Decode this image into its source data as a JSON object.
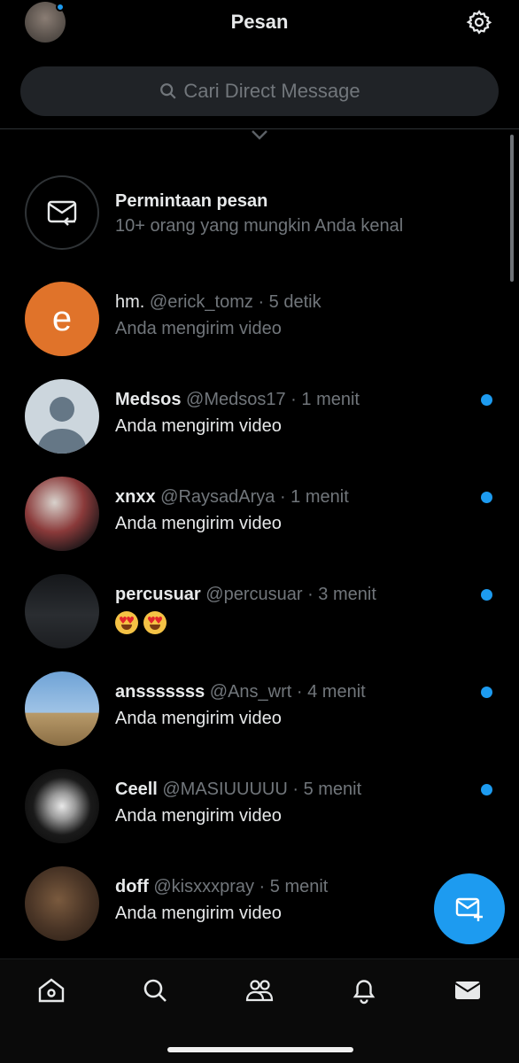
{
  "header": {
    "title": "Pesan",
    "avatar_icon": "user-avatar",
    "settings_icon": "gear-icon",
    "has_notification_dot": true
  },
  "search": {
    "placeholder": "Cari Direct Message",
    "icon": "search-icon"
  },
  "requests": {
    "title": "Permintaan pesan",
    "subtitle": "10+ orang yang mungkin Anda kenal",
    "icon": "mail-request-icon"
  },
  "conversations": [
    {
      "name": "hm.",
      "handle": "@erick_tomz",
      "time": "· 5 detik",
      "preview": "Anda mengirim video",
      "unread": false,
      "avatar_letter": "e",
      "avatar_color": "#e0732a"
    },
    {
      "name": "Medsos",
      "handle": "@Medsos17",
      "time": "· 1 menit",
      "preview": "Anda mengirim video",
      "unread": true
    },
    {
      "name": "xnxx",
      "handle": "@RaysadArya",
      "time": "· 1 menit",
      "preview": "Anda mengirim video",
      "unread": true
    },
    {
      "name": "percusuar",
      "handle": "@percusuar",
      "time": "· 3 menit",
      "preview": "😍 😍",
      "unread": true
    },
    {
      "name": "ansssssss",
      "handle": "@Ans_wrt",
      "time": "· 4 menit",
      "preview": "Anda mengirim video",
      "unread": true
    },
    {
      "name": "Ceell",
      "handle": "@MASIUUUUU",
      "time": "· 5 menit",
      "preview": "Anda mengirim video",
      "unread": true
    },
    {
      "name": "doff",
      "handle": "@kisxxxpray",
      "time": "· 5 menit",
      "preview": "Anda mengirim video",
      "unread": true
    }
  ],
  "fab": {
    "icon": "new-message-icon"
  },
  "tabbar": [
    {
      "icon": "home-icon"
    },
    {
      "icon": "search-icon"
    },
    {
      "icon": "communities-icon"
    },
    {
      "icon": "bell-icon"
    },
    {
      "icon": "mail-icon",
      "active": true
    }
  ],
  "colors": {
    "accent": "#1d9bf0",
    "background": "#000000",
    "muted_text": "#71767b"
  }
}
